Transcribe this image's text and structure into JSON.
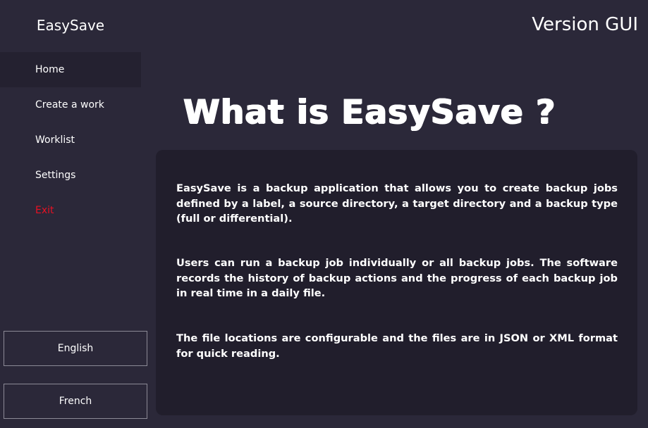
{
  "app": {
    "title": "EasySave",
    "version_label": "Version GUI"
  },
  "sidebar": {
    "items": [
      {
        "label": "Home",
        "active": true
      },
      {
        "label": "Create a work"
      },
      {
        "label": "Worklist"
      },
      {
        "label": "Settings"
      },
      {
        "label": "Exit"
      }
    ],
    "languages": [
      {
        "label": "English"
      },
      {
        "label": "French"
      }
    ]
  },
  "main": {
    "heading": "What is EasySave ?",
    "paragraphs": [
      "EasySave is a backup application that allows you to create backup jobs defined by a label, a source directory, a target directory and a backup type (full or differential).",
      "Users can run a backup job individually or all backup jobs. The software records the history of backup actions and the progress of each backup job in real time in a daily file.",
      "The file locations are configurable and the files are in JSON or XML format for quick reading."
    ]
  },
  "colors": {
    "background": "#2b2839",
    "card": "#211e2c",
    "active_nav": "#242130",
    "exit": "#e81123",
    "text": "#ffffff"
  }
}
